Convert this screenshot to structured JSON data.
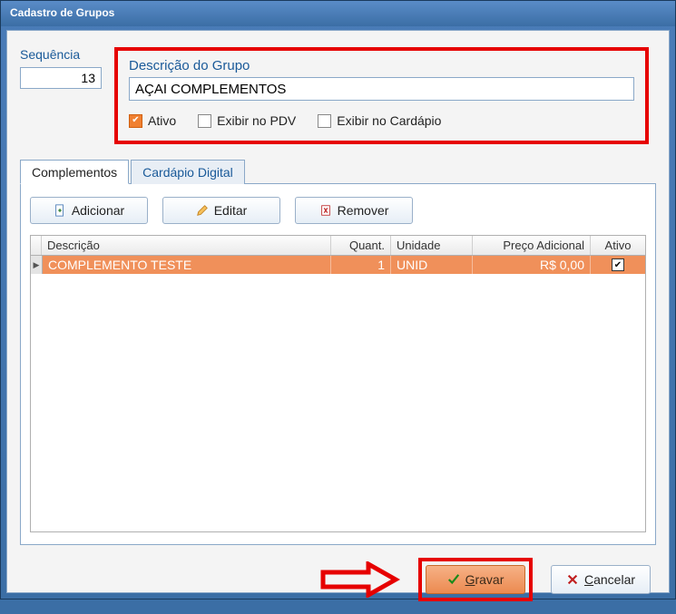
{
  "window_title": "Cadastro de Grupos",
  "sequencia": {
    "label": "Sequência",
    "value": "13"
  },
  "group": {
    "label": "Descrição do Grupo",
    "value": "AÇAI COMPLEMENTOS",
    "checks": {
      "ativo": {
        "label": "Ativo",
        "checked": true
      },
      "pdv": {
        "label": "Exibir no PDV",
        "checked": false
      },
      "cardapio": {
        "label": "Exibir no Cardápio",
        "checked": false
      }
    }
  },
  "tabs": {
    "complementos": "Complementos",
    "cardapio_digital": "Cardápio Digital"
  },
  "toolbar": {
    "adicionar": "Adicionar",
    "editar": "Editar",
    "remover": "Remover"
  },
  "grid": {
    "head": {
      "descricao": "Descrição",
      "quant": "Quant.",
      "unidade": "Unidade",
      "preco": "Preço Adicional",
      "ativo": "Ativo"
    },
    "row": {
      "descricao": "COMPLEMENTO TESTE",
      "quant": "1",
      "unidade": "UNID",
      "preco": "R$ 0,00",
      "ativo": true
    }
  },
  "footer": {
    "gravar_prefix": "G",
    "gravar_rest": "ravar",
    "cancelar_prefix": "C",
    "cancelar_rest": "ancelar"
  }
}
